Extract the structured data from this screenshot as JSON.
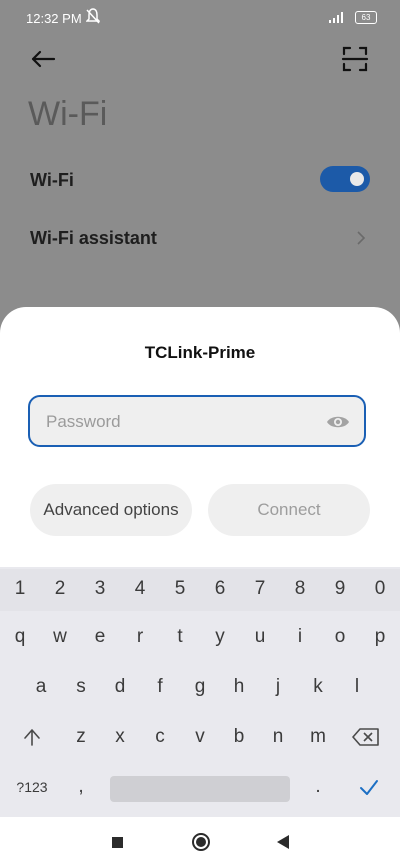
{
  "status_bar": {
    "time": "12:32 PM",
    "battery": "63"
  },
  "page": {
    "title": "Wi-Fi"
  },
  "settings": {
    "wifi_label": "Wi-Fi",
    "wifi_enabled": true,
    "assistant_label": "Wi-Fi assistant"
  },
  "dialog": {
    "network_name": "TCLink-Prime",
    "password_placeholder": "Password",
    "password_value": "",
    "advanced_label": "Advanced options",
    "connect_label": "Connect"
  },
  "keyboard": {
    "numbers": [
      "1",
      "2",
      "3",
      "4",
      "5",
      "6",
      "7",
      "8",
      "9",
      "0"
    ],
    "row1": [
      "q",
      "w",
      "e",
      "r",
      "t",
      "y",
      "u",
      "i",
      "o",
      "p"
    ],
    "row2": [
      "a",
      "s",
      "d",
      "f",
      "g",
      "h",
      "j",
      "k",
      "l"
    ],
    "row3": [
      "z",
      "x",
      "c",
      "v",
      "b",
      "n",
      "m"
    ],
    "symbols_label": "?123",
    "comma": ",",
    "period": "."
  },
  "colors": {
    "accent": "#1c5aa8",
    "dim_overlay": "#8c8c8c"
  }
}
